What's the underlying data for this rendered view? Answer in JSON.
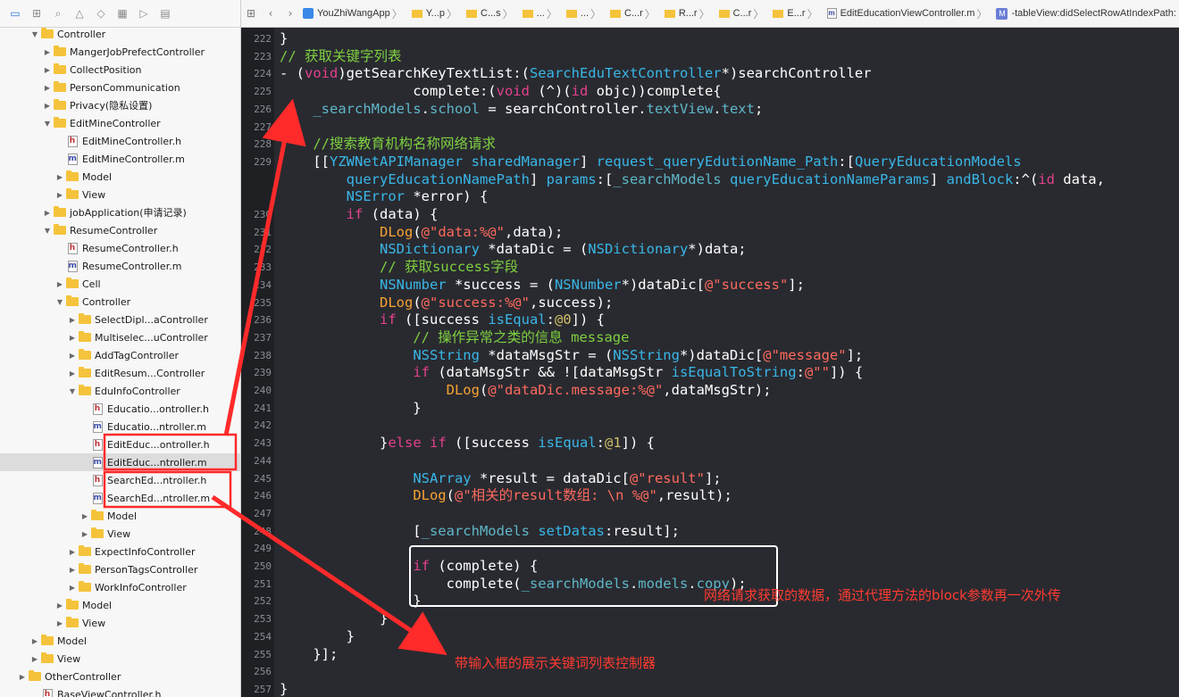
{
  "navigator_tree": [
    {
      "label": "Controller",
      "indent": 3,
      "type": "folder",
      "open": true
    },
    {
      "label": "MangerJobPrefectController",
      "indent": 4,
      "type": "folder",
      "open": false
    },
    {
      "label": "CollectPosition",
      "indent": 4,
      "type": "folder",
      "open": false
    },
    {
      "label": "PersonCommunication",
      "indent": 4,
      "type": "folder",
      "open": false
    },
    {
      "label": "Privacy(隐私设置)",
      "indent": 4,
      "type": "folder",
      "open": false
    },
    {
      "label": "EditMineController",
      "indent": 4,
      "type": "folder",
      "open": true
    },
    {
      "label": "EditMineController.h",
      "indent": 5,
      "type": "h"
    },
    {
      "label": "EditMineController.m",
      "indent": 5,
      "type": "m"
    },
    {
      "label": "Model",
      "indent": 5,
      "type": "folder",
      "open": false
    },
    {
      "label": "View",
      "indent": 5,
      "type": "folder",
      "open": false
    },
    {
      "label": "jobApplication(申请记录)",
      "indent": 4,
      "type": "folder",
      "open": false
    },
    {
      "label": "ResumeController",
      "indent": 4,
      "type": "folder",
      "open": true
    },
    {
      "label": "ResumeController.h",
      "indent": 5,
      "type": "h"
    },
    {
      "label": "ResumeController.m",
      "indent": 5,
      "type": "m"
    },
    {
      "label": "Cell",
      "indent": 5,
      "type": "folder",
      "open": false
    },
    {
      "label": "Controller",
      "indent": 5,
      "type": "folder",
      "open": true
    },
    {
      "label": "SelectDipl...aController",
      "indent": 6,
      "type": "folder",
      "open": false
    },
    {
      "label": "Multiselec...uController",
      "indent": 6,
      "type": "folder",
      "open": false
    },
    {
      "label": "AddTagController",
      "indent": 6,
      "type": "folder",
      "open": false
    },
    {
      "label": "EditResum...Controller",
      "indent": 6,
      "type": "folder",
      "open": false
    },
    {
      "label": "EduInfoController",
      "indent": 6,
      "type": "folder",
      "open": true
    },
    {
      "label": "Educatio...ontroller.h",
      "indent": 7,
      "type": "h"
    },
    {
      "label": "Educatio...ntroller.m",
      "indent": 7,
      "type": "m"
    },
    {
      "label": "EditEduc...ontroller.h",
      "indent": 7,
      "type": "h"
    },
    {
      "label": "EditEduc...ntroller.m",
      "indent": 7,
      "type": "m",
      "selected": true
    },
    {
      "label": "SearchEd...ntroller.h",
      "indent": 7,
      "type": "h"
    },
    {
      "label": "SearchEd...ntroller.m",
      "indent": 7,
      "type": "m"
    },
    {
      "label": "Model",
      "indent": 7,
      "type": "folder",
      "open": false
    },
    {
      "label": "View",
      "indent": 7,
      "type": "folder",
      "open": false
    },
    {
      "label": "ExpectInfoController",
      "indent": 6,
      "type": "folder",
      "open": false
    },
    {
      "label": "PersonTagsController",
      "indent": 6,
      "type": "folder",
      "open": false
    },
    {
      "label": "WorkInfoController",
      "indent": 6,
      "type": "folder",
      "open": false
    },
    {
      "label": "Model",
      "indent": 5,
      "type": "folder",
      "open": false
    },
    {
      "label": "View",
      "indent": 5,
      "type": "folder",
      "open": false
    },
    {
      "label": "Model",
      "indent": 3,
      "type": "folder",
      "open": false
    },
    {
      "label": "View",
      "indent": 3,
      "type": "folder",
      "open": false
    },
    {
      "label": "OtherController",
      "indent": 2,
      "type": "folder",
      "open": false
    },
    {
      "label": "BaseViewController.h",
      "indent": 3,
      "type": "h"
    }
  ],
  "navigator_icons": [
    "folder-icon",
    "hierarchy-icon",
    "search-icon",
    "warning-icon",
    "test-icon",
    "debug-icon",
    "breakpoint-icon",
    "report-icon"
  ],
  "jumpbar": {
    "back_icon": "chevron-left-icon",
    "forward_icon": "chevron-right-icon",
    "crumbs": [
      {
        "label": "YouZhiWangApp",
        "icon": "app"
      },
      {
        "label": "Y...p",
        "icon": "folder"
      },
      {
        "label": "C...s",
        "icon": "folder"
      },
      {
        "label": "...",
        "icon": "folder"
      },
      {
        "label": "...",
        "icon": "folder"
      },
      {
        "label": "C...r",
        "icon": "folder"
      },
      {
        "label": "R...r",
        "icon": "folder"
      },
      {
        "label": "C...r",
        "icon": "folder"
      },
      {
        "label": "E...r",
        "icon": "folder"
      },
      {
        "label": "EditEducationViewController.m",
        "icon": "m"
      },
      {
        "label": "-tableView:didSelectRowAtIndexPath:",
        "icon": "M"
      }
    ]
  },
  "code_lines": [
    {
      "ln": "222",
      "html": "}"
    },
    {
      "ln": "223",
      "html": "<span class='cmt'>// 获取关键字列表</span>"
    },
    {
      "ln": "224",
      "html": "- (<span class='kw'>void</span>)getSearchKeyTextList:(<span class='ty'>SearchEduTextController</span>*)searchController"
    },
    {
      "ln": "225",
      "html": "                complete:(<span class='kw'>void</span> (^)(<span class='kw'>id</span> objc))complete{"
    },
    {
      "ln": "226",
      "html": "    <span class='prop'>_searchModels</span>.<span class='prop'>school</span> = searchController.<span class='prop'>textView</span>.<span class='prop'>text</span>;"
    },
    {
      "ln": "227",
      "html": ""
    },
    {
      "ln": "228",
      "html": "    <span class='cmt'>//搜索教育机构名称网络请求</span>"
    },
    {
      "ln": "229",
      "html": "    [[<span class='ty'>YZWNetAPIManager</span> <span class='ty'>sharedManager</span>] <span class='ty'>request_queryEdutionName_Path</span>:[<span class='ty'>QueryEducationModels</span>"
    },
    {
      "ln": "",
      "html": "        <span class='ty'>queryEducationNamePath</span>] <span class='ty'>params</span>:[<span class='prop'>_searchModels</span> <span class='ty'>queryEducationNameParams</span>] <span class='ty'>andBlock</span>:^(<span class='kw'>id</span> data,"
    },
    {
      "ln": "",
      "html": "        <span class='ty'>NSError</span> *error) {"
    },
    {
      "ln": "230",
      "html": "        <span class='kw'>if</span> (data) {"
    },
    {
      "ln": "231",
      "html": "            <span class='mac'>DLog</span>(<span class='str'>@\"data:%@\"</span>,data);"
    },
    {
      "ln": "232",
      "html": "            <span class='ty'>NSDictionary</span> *dataDic = (<span class='ty'>NSDictionary</span>*)data;"
    },
    {
      "ln": "233",
      "html": "            <span class='cmt'>// 获取success字段</span>"
    },
    {
      "ln": "234",
      "html": "            <span class='ty'>NSNumber</span> *success = (<span class='ty'>NSNumber</span>*)dataDic[<span class='str'>@\"success\"</span>];"
    },
    {
      "ln": "235",
      "html": "            <span class='mac'>DLog</span>(<span class='str'>@\"success:%@\"</span>,success);"
    },
    {
      "ln": "236",
      "html": "            <span class='kw'>if</span> ([success <span class='ty'>isEqual</span>:<span class='num'>@0</span>]) {"
    },
    {
      "ln": "237",
      "html": "                <span class='cmt'>// 操作异常之类的信息 message</span>"
    },
    {
      "ln": "238",
      "html": "                <span class='ty'>NSString</span> *dataMsgStr = (<span class='ty'>NSString</span>*)dataDic[<span class='str'>@\"message\"</span>];"
    },
    {
      "ln": "239",
      "html": "                <span class='kw'>if</span> (dataMsgStr &amp;&amp; ![dataMsgStr <span class='ty'>isEqualToString</span>:<span class='str'>@\"\"</span>]) {"
    },
    {
      "ln": "240",
      "html": "                    <span class='mac'>DLog</span>(<span class='str'>@\"dataDic.message:%@\"</span>,dataMsgStr);"
    },
    {
      "ln": "241",
      "html": "                }"
    },
    {
      "ln": "242",
      "html": ""
    },
    {
      "ln": "243",
      "html": "            }<span class='kw'>else</span> <span class='kw'>if</span> ([success <span class='ty'>isEqual</span>:<span class='num'>@1</span>]) {"
    },
    {
      "ln": "244",
      "html": ""
    },
    {
      "ln": "245",
      "html": "                <span class='ty'>NSArray</span> *result = dataDic[<span class='str'>@\"result\"</span>];"
    },
    {
      "ln": "246",
      "html": "                <span class='mac'>DLog</span>(<span class='str'>@\"相关的result数组: \\n %@\"</span>,result);"
    },
    {
      "ln": "247",
      "html": ""
    },
    {
      "ln": "248",
      "html": "                [<span class='prop'>_searchModels</span> <span class='ty'>setDatas</span>:result];"
    },
    {
      "ln": "249",
      "html": ""
    },
    {
      "ln": "250",
      "html": "                <span class='kw'>if</span> (complete) {"
    },
    {
      "ln": "251",
      "html": "                    complete(<span class='prop'>_searchModels</span>.<span class='prop'>models</span>.<span class='prop'>copy</span>);"
    },
    {
      "ln": "252",
      "html": "                }"
    },
    {
      "ln": "253",
      "html": "            }"
    },
    {
      "ln": "254",
      "html": "        }"
    },
    {
      "ln": "255",
      "html": "    }];"
    },
    {
      "ln": "256",
      "html": ""
    },
    {
      "ln": "257",
      "html": "}"
    }
  ],
  "annotations": {
    "note1": "网络请求获取的数据，通过代理方法的block参数再一次外传",
    "note2": "带输入框的展示关键词列表控制器"
  },
  "colors": {
    "annotation": "#ff2a2a",
    "editor_bg": "#292a30",
    "comment": "#7ed040",
    "keyword": "#e3418d",
    "type": "#39b7e8",
    "string": "#fd6a5d"
  }
}
